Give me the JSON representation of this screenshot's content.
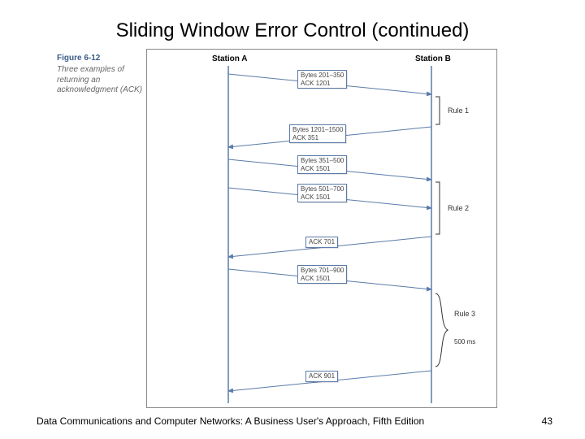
{
  "slide": {
    "title": "Sliding Window Error Control (continued)",
    "footer": "Data Communications and Computer Networks: A Business User's Approach, Fifth Edition",
    "page": "43"
  },
  "figure": {
    "label": "Figure 6-12",
    "caption": "Three examples of returning an acknowledgment (ACK)"
  },
  "diagram": {
    "stationA": "Station A",
    "stationB": "Station B",
    "rules": {
      "r1": "Rule 1",
      "r2": "Rule 2",
      "r3": "Rule 3"
    },
    "timeout": "500 ms",
    "messages": {
      "m1a": "Bytes 201–350",
      "m1b": "ACK 1201",
      "m2a": "Bytes 1201–1500",
      "m2b": "ACK 351",
      "m3a": "Bytes 351–500",
      "m3b": "ACK 1501",
      "m4a": "Bytes 501–700",
      "m4b": "ACK 1501",
      "m5": "ACK 701",
      "m6a": "Bytes 701–900",
      "m6b": "ACK 1501",
      "m7": "ACK 901"
    }
  }
}
